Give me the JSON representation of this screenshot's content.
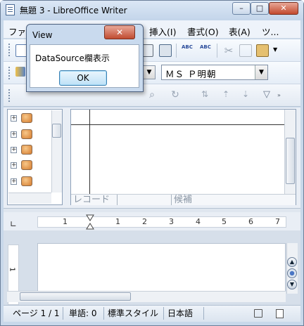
{
  "window": {
    "title": "無題 3 - LibreOffice Writer",
    "min_label": "–",
    "max_label": "□",
    "close_label": "✕"
  },
  "menu": {
    "items": [
      {
        "label": "ファ"
      },
      {
        "label": "挿入(I)"
      },
      {
        "label": "書式(O)"
      },
      {
        "label": "表(A)"
      },
      {
        "label": "ツ..."
      }
    ]
  },
  "toolbar": {
    "font_name": "ＭＳ Ｐ明朝",
    "dropdown_arrow": "▼"
  },
  "datasource": {
    "grid_footer": {
      "record": "レコード",
      "candidate": "候補"
    }
  },
  "ruler": {
    "numbers": [
      "1",
      "1",
      "2",
      "3",
      "4",
      "5",
      "6",
      "7"
    ]
  },
  "vruler": {
    "number": "1"
  },
  "statusbar": {
    "page": "ページ 1 / 1",
    "words": "単語: 0",
    "style": "標準スタイル",
    "language": "日本語"
  },
  "dialog": {
    "title": "View",
    "message": "DataSource欄表示",
    "ok_label": "OK",
    "close_label": "✕"
  },
  "colors": {
    "accent": "#3c7fb1",
    "close": "#c2492e",
    "frame": "#c8d8ea"
  }
}
